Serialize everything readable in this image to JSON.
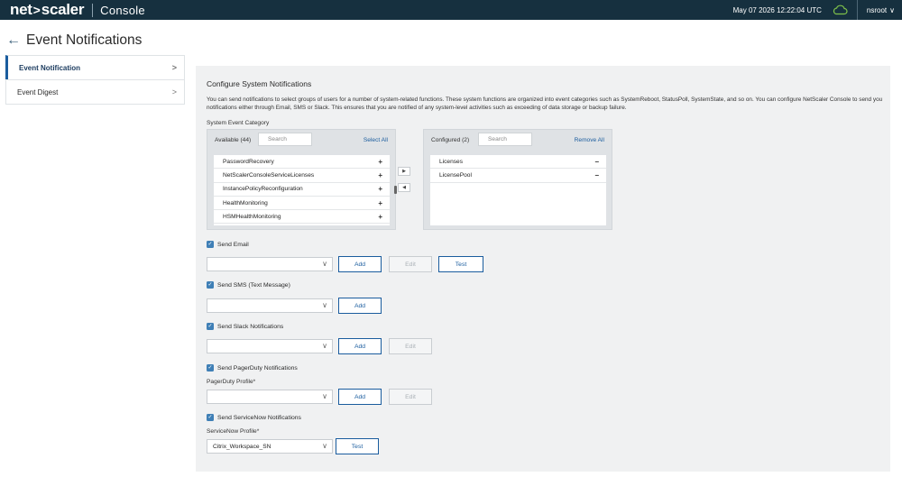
{
  "topbar": {
    "brand_net": "net",
    "brand_arrow": ">",
    "brand_scaler": "scaler",
    "brand_product": "Console",
    "datetime": "May 07 2026 12:22:04 UTC",
    "username": "nsroot",
    "user_chevron": "∨",
    "colors": {
      "background": "#16303f"
    }
  },
  "page": {
    "back_icon": "←",
    "title": "Event Notifications"
  },
  "sidebar": {
    "items": [
      {
        "label": "Event Notification",
        "chevron": ">",
        "active": true
      },
      {
        "label": "Event Digest",
        "chevron": ">",
        "active": false
      }
    ]
  },
  "main": {
    "section_title": "Configure System Notifications",
    "description": "You can send notifications to select groups of users for a number of system-related functions. These system functions are organized into event categories such as SystemReboot, StatusPoll, SystemState, and so on. You can configure NetScaler Console to send you notifications either through Email, SMS or Slack. This ensures that you are notified of any system-level activities such as exceeding of data storage or backup failure.",
    "category_label": "System Event Category",
    "available": {
      "title": "Available (44)",
      "search_placeholder": "Search",
      "action": "Select All",
      "items": [
        {
          "label": "PasswordRecovery",
          "op": "+"
        },
        {
          "label": "NetScalerConsoleServiceLicenses",
          "op": "+"
        },
        {
          "label": "InstancePolicyReconfiguration",
          "op": "+"
        },
        {
          "label": "HealthMonitoring",
          "op": "+"
        },
        {
          "label": "HSMHealthMonitoring",
          "op": "+"
        }
      ]
    },
    "move_buttons": {
      "right": "▶",
      "left": "◀"
    },
    "configured": {
      "title": "Configured (2)",
      "search_placeholder": "Search",
      "action": "Remove All",
      "items": [
        {
          "label": "Licenses",
          "op": "−"
        },
        {
          "label": "LicensePool",
          "op": "−"
        }
      ]
    },
    "email": {
      "checkbox_label": "Send Email",
      "checked": true,
      "select_value": "",
      "add": "Add",
      "edit": "Edit",
      "test": "Test"
    },
    "sms": {
      "checkbox_label": "Send SMS (Text Message)",
      "checked": true,
      "select_value": "",
      "add": "Add"
    },
    "slack": {
      "checkbox_label": "Send Slack Notifications",
      "checked": true,
      "select_value": "",
      "add": "Add",
      "edit": "Edit"
    },
    "pagerduty": {
      "checkbox_label": "Send PagerDuty Notifications",
      "checked": true,
      "profile_label": "PagerDuty Profile*",
      "select_value": "",
      "add": "Add",
      "edit": "Edit"
    },
    "servicenow": {
      "checkbox_label": "Send ServiceNow Notifications",
      "checked": true,
      "profile_label": "ServiceNow Profile*",
      "select_value": "Citrix_Workspace_SN",
      "test": "Test"
    },
    "checkmark": "✓",
    "caret": "∨",
    "colors": {
      "accent": "#1a5c9e",
      "checkbox": "#3f7fb6",
      "panel": "#f0f1f2"
    }
  }
}
